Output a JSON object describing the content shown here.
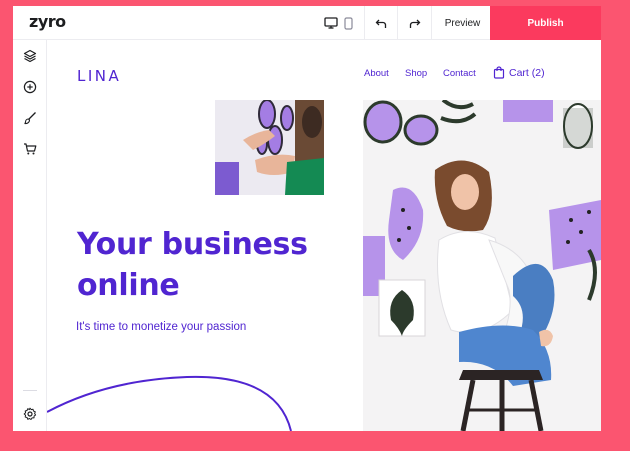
{
  "app": {
    "logo_text": "zyro"
  },
  "toolbar": {
    "preview_label": "Preview",
    "publish_label": "Publish",
    "icons": [
      "desktop-view-icon",
      "mobile-view-icon",
      "undo-icon",
      "redo-icon"
    ]
  },
  "sidebar": {
    "icons": [
      "layers-icon",
      "add-element-icon",
      "brush-icon",
      "cart-icon",
      "settings-icon"
    ]
  },
  "site": {
    "brand": "LINA",
    "nav": [
      "About",
      "Shop",
      "Contact"
    ],
    "cart_label": "Cart (2)",
    "headline_line1": "Your business",
    "headline_line2": "online",
    "subheadline": "It's time to monetize your passion"
  },
  "colors": {
    "background": "#fb5570",
    "publish": "#fb3a5e",
    "brand_purple": "#5025d1"
  }
}
